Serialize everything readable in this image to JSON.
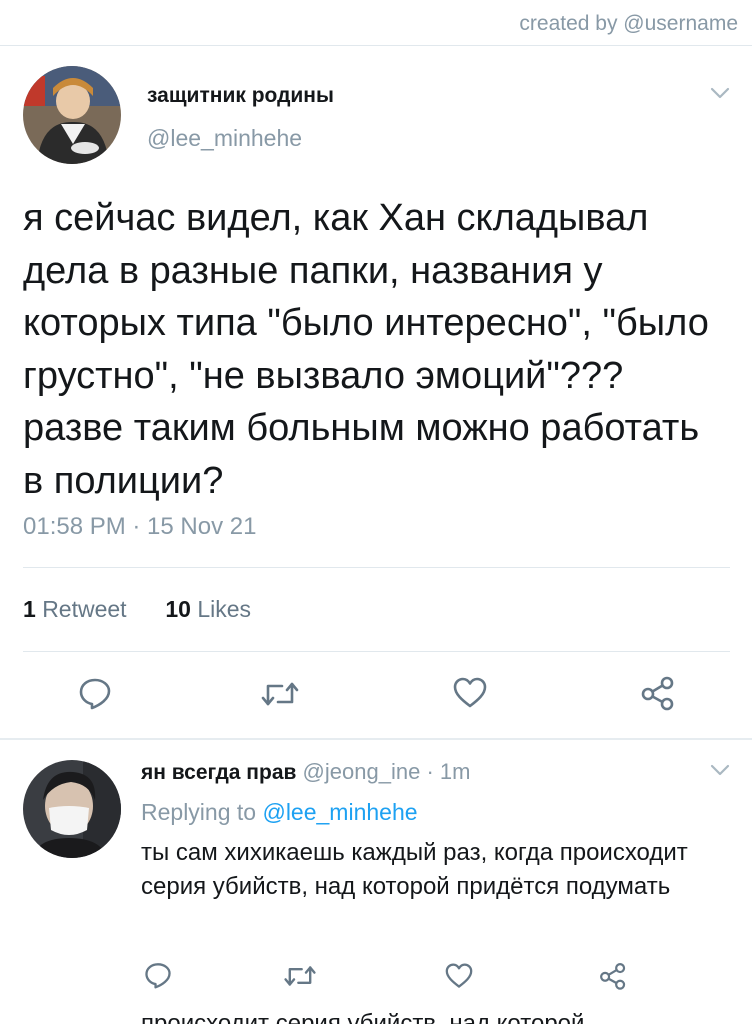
{
  "credit": "created by @username",
  "tweet": {
    "display_name": "защитник родины",
    "handle": "@lee_minhehe",
    "text": "я сейчас видел, как Хан складывал дела в разные папки, названия у которых типа \"было интересно\", \"было грустно\", \"не вызвало эмоций\"??? разве таким больным можно работать в полиции?",
    "time": "01:58 PM · 15 Nov 21",
    "retweets_count": "1",
    "retweets_label": "Retweet",
    "likes_count": "10",
    "likes_label": "Likes"
  },
  "reply": {
    "display_name": "ян всегда прав",
    "handle": "@jeong_ine",
    "time": "· 1m",
    "replying_prefix": "Replying to",
    "replying_to": "@lee_minhehe",
    "text": "ты сам хихикаешь каждый раз, когда происходит серия убийств, над которой придётся подумать"
  },
  "cutoff_text": "происходит серия убийств, над которой",
  "colors": {
    "text_primary": "#14171a",
    "text_secondary": "#8899a6",
    "link": "#1da1f2",
    "divider": "#e1e8ed"
  },
  "icons": [
    "chevron-down-icon",
    "reply-icon",
    "retweet-icon",
    "like-icon",
    "share-icon"
  ]
}
